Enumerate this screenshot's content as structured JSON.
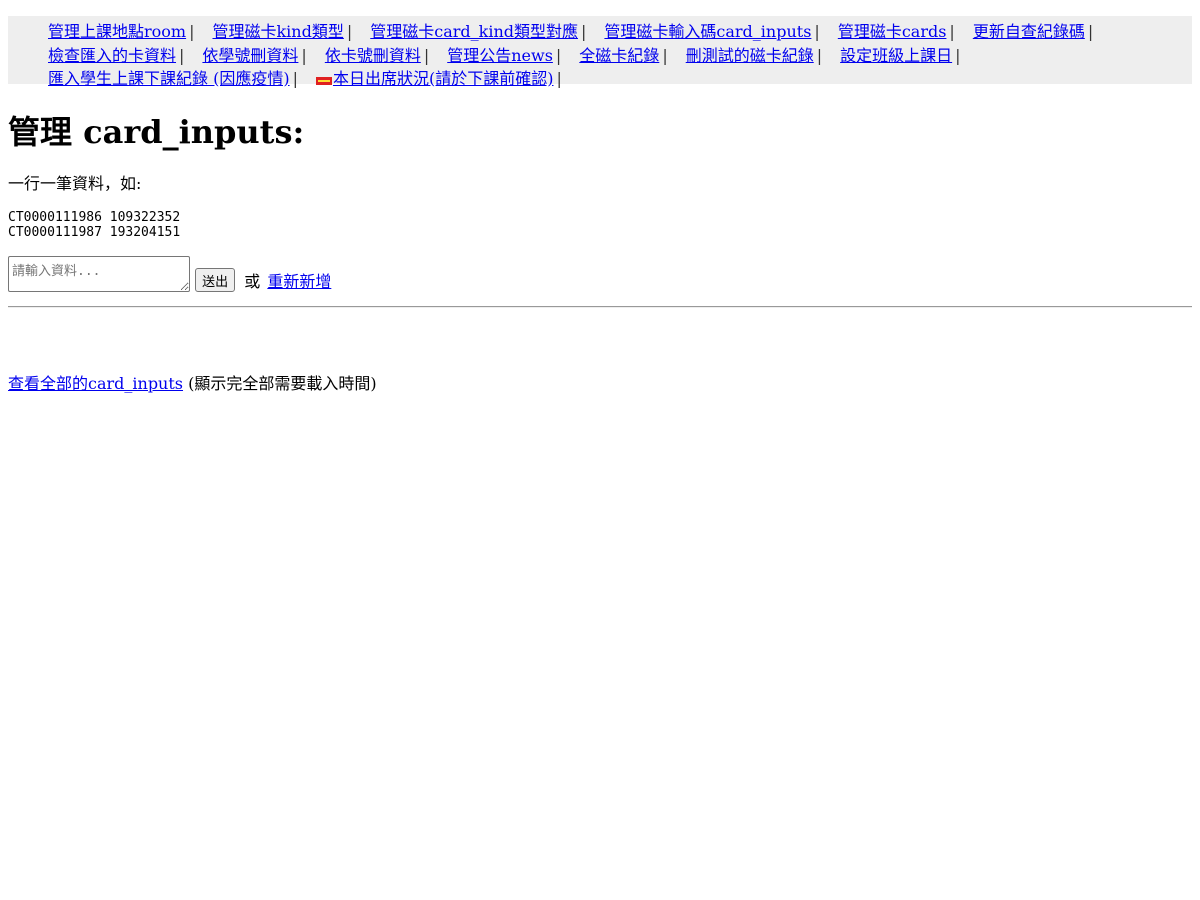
{
  "nav": {
    "rows": [
      [
        {
          "label": "管理上課地點room",
          "badge": false
        },
        {
          "label": "管理磁卡kind類型",
          "badge": false
        },
        {
          "label": "管理磁卡card_kind類型對應",
          "badge": false
        },
        {
          "label": "管理磁卡輸入碼card_inputs",
          "badge": false
        },
        {
          "label": "管理磁卡cards",
          "badge": false
        },
        {
          "label": "更新自查紀錄碼",
          "badge": false
        }
      ],
      [
        {
          "label": "檢查匯入的卡資料",
          "badge": false
        },
        {
          "label": "依學號刪資料",
          "badge": false
        },
        {
          "label": "依卡號刪資料",
          "badge": false
        },
        {
          "label": "管理公告news",
          "badge": false
        },
        {
          "label": "全磁卡紀錄",
          "badge": false
        },
        {
          "label": "刪測試的磁卡紀錄",
          "badge": false
        },
        {
          "label": "設定班級上課日",
          "badge": false
        }
      ],
      [
        {
          "label": "匯入學生上課下課紀錄 (因應疫情)",
          "badge": false
        },
        {
          "label": "本日出席狀況(請於下課前確認)",
          "badge": true
        }
      ]
    ],
    "separator": "|"
  },
  "main": {
    "title": "管理 card_inputs:",
    "instruction": "一行一筆資料，如:",
    "example": "CT0000111986 109322352\nCT0000111987 193204151",
    "form": {
      "placeholder": "請輸入資料...",
      "value": "",
      "submit_label": "送出",
      "or_text": "或",
      "reset_label": "重新新增"
    },
    "view_all": {
      "link_label": "查看全部的card_inputs",
      "note": "(顯示完全部需要載入時間)"
    }
  },
  "colors": {
    "link": "#0000ee",
    "nav_background": "#eeeeee",
    "badge": "#e02020"
  }
}
